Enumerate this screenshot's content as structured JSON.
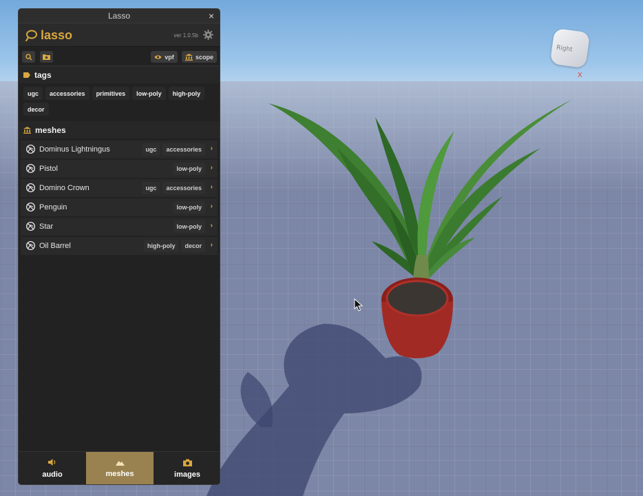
{
  "window": {
    "title": "Lasso",
    "close_glyph": "×"
  },
  "app": {
    "name": "lasso",
    "version": "ver 1.0.5b",
    "accent": "#d9a83f"
  },
  "toolbar": {
    "search_icon": "search-icon",
    "folder_icon": "folder-icon",
    "vpf_label": "vpf",
    "scope_label": "scope"
  },
  "tags_section": {
    "label": "tags",
    "tags": [
      "ugc",
      "accessories",
      "primitives",
      "low-poly",
      "high-poly",
      "decor"
    ]
  },
  "meshes_section": {
    "label": "meshes",
    "items": [
      {
        "name": "Dominus Lightningus",
        "tags": [
          "ugc",
          "accessories"
        ]
      },
      {
        "name": "Pistol",
        "tags": [
          "low-poly"
        ]
      },
      {
        "name": "Domino Crown",
        "tags": [
          "ugc",
          "accessories"
        ]
      },
      {
        "name": "Penguin",
        "tags": [
          "low-poly"
        ]
      },
      {
        "name": "Star",
        "tags": [
          "low-poly"
        ]
      },
      {
        "name": "Oil Barrel",
        "tags": [
          "high-poly",
          "decor"
        ]
      }
    ],
    "chevron": "›"
  },
  "bottom_nav": {
    "tabs": [
      {
        "label": "audio",
        "icon": "speaker-icon",
        "active": false
      },
      {
        "label": "meshes",
        "icon": "mountain-icon",
        "active": true
      },
      {
        "label": "images",
        "icon": "camera-icon",
        "active": false
      }
    ],
    "active_color": "#9a8250"
  },
  "viewport": {
    "view_cube_face": "Right",
    "axis_label": "X"
  }
}
